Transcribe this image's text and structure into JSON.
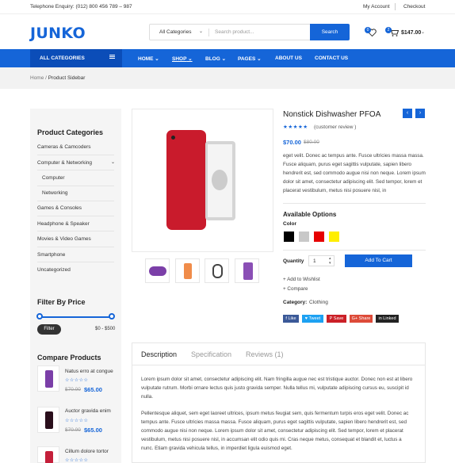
{
  "topbar": {
    "phone": "Telephone Enquiry: (012) 800 456 789 – 987",
    "account": "My Account",
    "checkout": "Checkout"
  },
  "header": {
    "logo": "JUNKO",
    "search": {
      "category": "All Categories",
      "placeholder": "Search product...",
      "button": "Search"
    },
    "wishlist_count": "0",
    "cart_count": "2",
    "cart_total": "$147.00"
  },
  "nav": {
    "all_categories": "ALL CATEGORIES",
    "items": [
      "HOME",
      "SHOP",
      "BLOG",
      "PAGES",
      "ABOUT US",
      "CONTACT US"
    ],
    "active": "SHOP"
  },
  "breadcrumb": {
    "home": "Home",
    "current": "Product Sidebar"
  },
  "sidebar": {
    "categories_title": "Product Categories",
    "categories": [
      "Cameras & Camcoders",
      "Computer & Networking",
      "Computer",
      "Networking",
      "Games & Consoles",
      "Headphone & Speaker",
      "Movies & Video Games",
      "Smartphone",
      "Uncategorized"
    ],
    "price_title": "Filter By Price",
    "filter_button": "Filter",
    "price_range": "$0 - $500",
    "compare_title": "Compare Products",
    "compare": [
      {
        "name": "Natus erro at congue",
        "old": "$70.00",
        "price": "$65.00"
      },
      {
        "name": "Auctor gravida enim",
        "old": "$70.00",
        "price": "$65.00"
      },
      {
        "name": "Cillum dolore tortor",
        "old": "",
        "price": ""
      }
    ]
  },
  "product": {
    "title": "Nonstick Dishwasher PFOA",
    "stars": "★★★★★",
    "review": "(customer review )",
    "price": "$70.00",
    "old_price": "$80.00",
    "description": "eget velit. Donec ac tempus ante. Fusce ultricies massa massa. Fusce aliquam, purus eget sagittis vulputate, sapien libero hendrerit est, sed commodo augue nisi non neque. Lorem ipsum dolor sit amet, consectetur adipiscing elit. Sed tempor, lorem et placerat vestibulum, metus nisi posuere nisl, in",
    "options_title": "Available Options",
    "color_label": "Color",
    "colors": [
      "#000000",
      "#c8c8c8",
      "#e60000",
      "#ffee00"
    ],
    "qty_label": "Quantity",
    "qty_value": "1",
    "add_to_cart": "Add To Cart",
    "wishlist": "+ Add to Wishlist",
    "compare": "+ Compare",
    "category_label": "Category:",
    "category_value": "Clothing",
    "share": [
      "Like",
      "Tweet",
      "Save",
      "Share",
      "Linked"
    ],
    "share_colors": [
      "#3b5998",
      "#1da1f2",
      "#cb2027",
      "#dd4b39",
      "#222222"
    ]
  },
  "tabs": {
    "labels": [
      "Description",
      "Specification",
      "Reviews (1)"
    ],
    "p1": "Lorem ipsum dolor sit amet, consectetur adipiscing elit. Nam fringilla augue nec est tristique auctor. Donec non est at libero vulputate rutrum. Morbi ornare lectus quis justo gravida semper. Nulla tellus mi, vulputate adipiscing cursus eu, suscipit id nulla.",
    "p2": "Pellentesque aliquet, sem eget laoreet ultrices, ipsum metus feugiat sem, quis fermentum turpis eros eget velit. Donec ac tempus ante. Fusce ultricies massa massa. Fusce aliquam, purus eget sagittis vulputate, sapien libero hendrerit est, sed commodo augue nisi non neque. Lorem ipsum dolor sit amet, consectetur adipiscing elit. Sed tempor, lorem et placerat vestibulum, metus nisi posuere nisl, in accumsan elit odio quis mi. Cras neque metus, consequat et blandit et, luctus a nunc. Etiam gravida vehicula tellus, in imperdiet ligula euismod eget."
  },
  "accent": "#1565d8"
}
